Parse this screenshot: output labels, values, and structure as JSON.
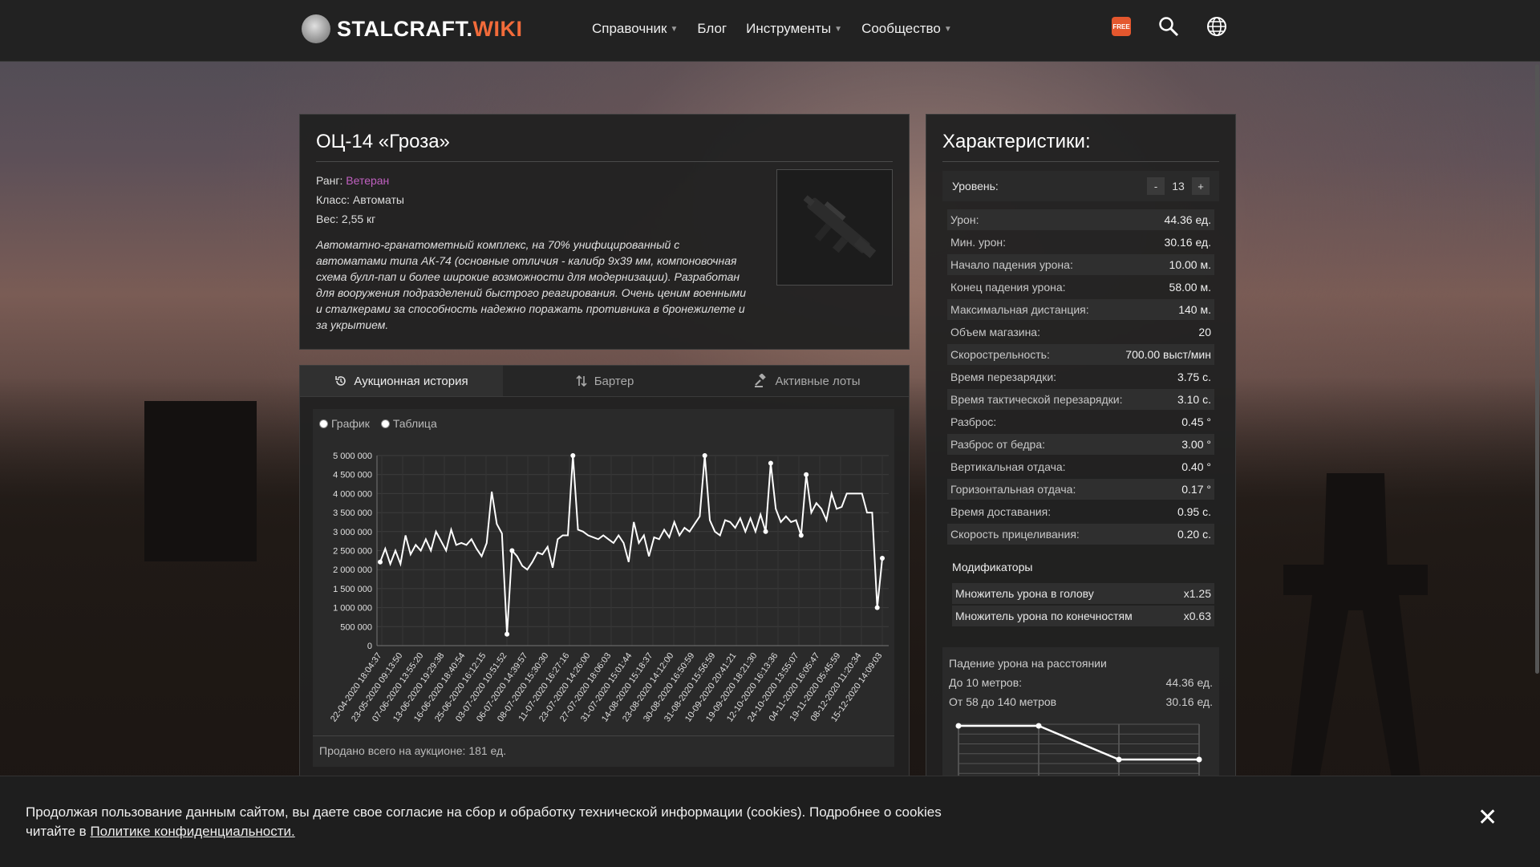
{
  "nav": {
    "logo_main": "STALCRAFT.",
    "logo_accent": "WIKI",
    "items": [
      {
        "label": "Справочник",
        "has_dropdown": true
      },
      {
        "label": "Блог",
        "has_dropdown": false
      },
      {
        "label": "Инструменты",
        "has_dropdown": true
      },
      {
        "label": "Сообщество",
        "has_dropdown": true
      }
    ],
    "free_badge": "FREE",
    "icons": [
      "free-icon",
      "search-icon",
      "globe-icon"
    ]
  },
  "item": {
    "title": "ОЦ-14 «Гроза»",
    "rank_label": "Ранг:",
    "rank_value": "Ветеран",
    "rank_color": "#c060c0",
    "class_line": "Класс: Автоматы",
    "weight_line": "Вес: 2,55 кг",
    "description": "Автоматно-гранатометный комплекс, на 70% унифицированный с автоматами типа АК-74 (основные отличия - калибр 9x39 мм, компоновочная схема булл-пап и более широкие возможности для модернизации). Разработан для вооружения подразделений быстрого реагирования. Очень ценим военными и сталкерами за способность надежно поражать противника в бронежилете и за укрытием."
  },
  "tabs": [
    {
      "label": "Аукционная история",
      "icon": "history-icon",
      "active": true
    },
    {
      "label": "Бартер",
      "icon": "swap-icon",
      "active": false
    },
    {
      "label": "Активные лоты",
      "icon": "gavel-icon",
      "active": false
    }
  ],
  "view_toggle": {
    "graph_label": "График",
    "table_label": "Таблица"
  },
  "sold_total": "Продано всего на аукционе: 181 ед.",
  "chart_data": {
    "type": "line",
    "ylim": [
      0,
      5000000
    ],
    "yticks": [
      "5 000 000",
      "4 500 000",
      "4 000 000",
      "3 500 000",
      "3 000 000",
      "2 500 000",
      "2 000 000",
      "1 500 000",
      "1 000 000",
      "500 000",
      "0"
    ],
    "x_tick_labels": [
      "22-04-2020 18:04:37",
      "23-05-2020 09:13:50",
      "07-06-2020 13:55:20",
      "13-06-2020 19:29:38",
      "16-06-2020 18:40:54",
      "25-06-2020 16:12:15",
      "03-07-2020 10:51:52",
      "06-07-2020 14:39:57",
      "08-07-2020 15:30:30",
      "11-07-2020 16:27:16",
      "23-07-2020 14:26:00",
      "27-07-2020 18:06:03",
      "31-07-2020 15:01:44",
      "14-08-2020 15:18:37",
      "23-08-2020 14:12:00",
      "30-08-2020 16:50:59",
      "31-08-2020 15:56:59",
      "10-09-2020 20:41:21",
      "19-09-2020 18:21:30",
      "12-10-2020 16:13:36",
      "24-10-2020 13:55:07",
      "04-11-2020 16:05:47",
      "19-11-2020 05:45:59",
      "08-12-2020 11:20:34",
      "15-12-2020 14:09:03"
    ],
    "values": [
      2200000,
      2550000,
      2150000,
      2500000,
      2150000,
      2900000,
      2400000,
      2650000,
      2500000,
      2800000,
      2500000,
      3000000,
      2750000,
      2500000,
      3050000,
      2650000,
      2700000,
      2650000,
      2800000,
      2550000,
      2350000,
      2700000,
      4050000,
      3200000,
      2950000,
      300000,
      2500000,
      2350000,
      2100000,
      2000000,
      2200000,
      2450000,
      2400000,
      2600000,
      2050000,
      2800000,
      2900000,
      2900000,
      5000000,
      3050000,
      3000000,
      2900000,
      2850000,
      2800000,
      2900000,
      2800000,
      2700000,
      2900000,
      2700000,
      2200000,
      3250000,
      2700000,
      2900000,
      2350000,
      2850000,
      2800000,
      3050000,
      2850000,
      3250000,
      2900000,
      3100000,
      3000000,
      3200000,
      3400000,
      5000000,
      3300000,
      3000000,
      2900000,
      3300000,
      3250000,
      3100000,
      3350000,
      3000000,
      3350000,
      3000000,
      3450000,
      3000000,
      4800000,
      3600000,
      3250000,
      3400000,
      3250000,
      3300000,
      2900000,
      4500000,
      3500000,
      3750000,
      3600000,
      3300000,
      4000000,
      3600000,
      3650000,
      4000000,
      4000000,
      4000000,
      4000000,
      3500000,
      3500000,
      1000000,
      2300000
    ]
  },
  "stats": {
    "title": "Характеристики:",
    "level_label": "Уровень:",
    "level_value": "13",
    "level_minus": "-",
    "level_plus": "+",
    "rows": [
      {
        "k": "Урон:",
        "v": "44.36 ед."
      },
      {
        "k": "Мин. урон:",
        "v": "30.16 ед."
      },
      {
        "k": "Начало падения урона:",
        "v": "10.00 м."
      },
      {
        "k": "Конец падения урона:",
        "v": "58.00 м."
      },
      {
        "k": "Максимальная дистанция:",
        "v": "140 м."
      },
      {
        "k": "Объем магазина:",
        "v": "20"
      },
      {
        "k": "Скорострельность:",
        "v": "700.00 выст/мин"
      },
      {
        "k": "Время перезарядки:",
        "v": "3.75 с."
      },
      {
        "k": "Время тактической перезарядки:",
        "v": "3.10 с."
      },
      {
        "k": "Разброс:",
        "v": "0.45 °"
      },
      {
        "k": "Разброс от бедра:",
        "v": "3.00 °"
      },
      {
        "k": "Вертикальная отдача:",
        "v": "0.40 °"
      },
      {
        "k": "Горизонтальная отдача:",
        "v": "0.17 °"
      },
      {
        "k": "Время доставания:",
        "v": "0.95 с."
      },
      {
        "k": "Скорость прицеливания:",
        "v": "0.20 с."
      }
    ],
    "mods_title": "Модификаторы",
    "mods": [
      {
        "k": "Множитель урона в голову",
        "v": "x1.25"
      },
      {
        "k": "Множитель урона по конечностям",
        "v": "x0.63"
      }
    ],
    "falloff": {
      "title": "Падение урона на расстоянии",
      "row1_k": "До 10 метров:",
      "row1_v": "44.36 ед.",
      "row2_k": "От 58 до 140 метров",
      "row2_v": "30.16 ед.",
      "points": [
        [
          0,
          44.36
        ],
        [
          10,
          44.36
        ],
        [
          58,
          30.16
        ],
        [
          140,
          30.16
        ]
      ]
    }
  },
  "cookie": {
    "text": "Продолжая пользование данным сайтом, вы даете свое согласие на сбор и обработку технической информации (cookies). Подробнее о cookies читайте в ",
    "link": "Политике конфиденциальности."
  }
}
